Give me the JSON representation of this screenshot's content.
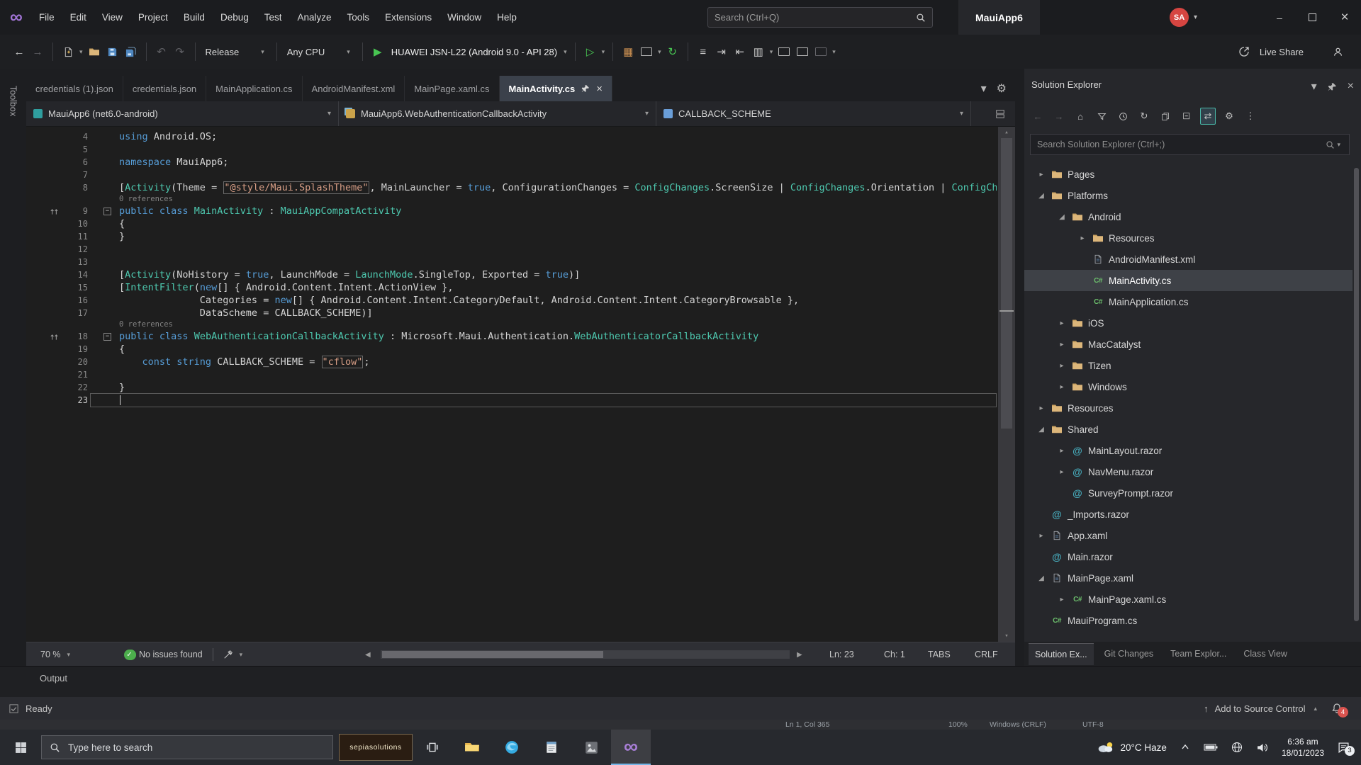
{
  "colors": {
    "keyword_blue": "#569cd6",
    "type_teal": "#4ec9b0",
    "string_orange": "#d69d85",
    "folder_yellow": "#dcb67a",
    "run_green": "#48c552",
    "badge_red": "#d9534f",
    "selection_gray": "#3e4147"
  },
  "glyphs": {
    "caret_down": "▾",
    "caret_up": "▴",
    "close": "×",
    "minimize": "–",
    "back": "←",
    "forward": "→",
    "undo": "↶",
    "redo": "↷",
    "play": "▶",
    "play_outline": "▷",
    "home": "⌂",
    "refresh": "↻",
    "swap": "⇄",
    "gear": "⚙",
    "more": "⋮",
    "check": "✓",
    "up_arrow": "↑",
    "collapsed": "▸",
    "expanded": "◢",
    "infinity": "∞",
    "lines": "≡",
    "indent": "⇥",
    "outdent": "⇤",
    "grid": "▦",
    "grid2": "▥",
    "share": "↗",
    "minus": "−",
    "left": "◀",
    "right": "▶",
    "ellipsis": "…"
  },
  "title_bar": {
    "menus": [
      "File",
      "Edit",
      "View",
      "Project",
      "Build",
      "Debug",
      "Test",
      "Analyze",
      "Tools",
      "Extensions",
      "Window",
      "Help"
    ],
    "search_placeholder": "Search (Ctrl+Q)",
    "window_title": "MauiApp6",
    "avatar": "SA"
  },
  "toolbar": {
    "config": "Release",
    "platform": "Any CPU",
    "run_target": "HUAWEI JSN-L22 (Android 9.0 - API 28)",
    "live_share": "Live Share"
  },
  "tabs": [
    {
      "label": "credentials (1).json",
      "active": false
    },
    {
      "label": "credentials.json",
      "active": false
    },
    {
      "label": "MainApplication.cs",
      "active": false
    },
    {
      "label": "AndroidManifest.xml",
      "active": false
    },
    {
      "label": "MainPage.xaml.cs",
      "active": false
    },
    {
      "label": "MainActivity.cs",
      "active": true
    }
  ],
  "breadcrumbs": [
    "MauiApp6 (net6.0-android)",
    "MauiApp6.WebAuthenticationCallbackActivity",
    "CALLBACK_SCHEME"
  ],
  "editor": {
    "zoom": "70 %",
    "issues": "No issues found",
    "line_status": "Ln: 23",
    "col_status": "Ch: 1",
    "tabs_status": "TABS",
    "eol_status": "CRLF",
    "lines": [
      {
        "n": 4,
        "t": [
          [
            "kw",
            "using"
          ],
          [
            "pl",
            " Android.OS;"
          ]
        ]
      },
      {
        "n": 5,
        "t": []
      },
      {
        "n": 6,
        "t": [
          [
            "kw",
            "namespace"
          ],
          [
            "pl",
            " MauiApp6;"
          ]
        ]
      },
      {
        "n": 7,
        "t": []
      },
      {
        "n": 8,
        "t": [
          [
            "pl",
            "["
          ],
          [
            "ty",
            "Activity"
          ],
          [
            "pl",
            "(Theme = "
          ],
          [
            "sb",
            "\"@style/Maui.SplashTheme\""
          ],
          [
            "pl",
            ", MainLauncher = "
          ],
          [
            "kw",
            "true"
          ],
          [
            "pl",
            ", ConfigurationChanges = "
          ],
          [
            "ty",
            "ConfigChanges"
          ],
          [
            "pl",
            ".ScreenSize | "
          ],
          [
            "ty",
            "ConfigChanges"
          ],
          [
            "pl",
            ".Orientation | "
          ],
          [
            "ty",
            "ConfigChar"
          ]
        ]
      },
      {
        "cl": "0 references"
      },
      {
        "n": 9,
        "fold": true,
        "glyph": true,
        "t": [
          [
            "kw",
            "public"
          ],
          [
            "pl",
            " "
          ],
          [
            "kw",
            "class"
          ],
          [
            "pl",
            " "
          ],
          [
            "ty",
            "MainActivity"
          ],
          [
            "pl",
            " : "
          ],
          [
            "ty",
            "MauiAppCompatActivity"
          ]
        ]
      },
      {
        "n": 10,
        "t": [
          [
            "pl",
            "{"
          ]
        ]
      },
      {
        "n": 11,
        "t": [
          [
            "pl",
            "}"
          ]
        ]
      },
      {
        "n": 12,
        "t": []
      },
      {
        "n": 13,
        "t": []
      },
      {
        "n": 14,
        "t": [
          [
            "pl",
            "["
          ],
          [
            "ty",
            "Activity"
          ],
          [
            "pl",
            "(NoHistory = "
          ],
          [
            "kw",
            "true"
          ],
          [
            "pl",
            ", LaunchMode = "
          ],
          [
            "ty",
            "LaunchMode"
          ],
          [
            "pl",
            ".SingleTop, Exported = "
          ],
          [
            "kw",
            "true"
          ],
          [
            "pl",
            ")]"
          ]
        ]
      },
      {
        "n": 15,
        "t": [
          [
            "pl",
            "["
          ],
          [
            "ty",
            "IntentFilter"
          ],
          [
            "pl",
            "("
          ],
          [
            "kw",
            "new"
          ],
          [
            "pl",
            "[] { Android.Content.Intent.ActionView },"
          ]
        ]
      },
      {
        "n": 16,
        "t": [
          [
            "pl",
            "              Categories = "
          ],
          [
            "kw",
            "new"
          ],
          [
            "pl",
            "[] { Android.Content.Intent.CategoryDefault, Android.Content.Intent.CategoryBrowsable },"
          ]
        ]
      },
      {
        "n": 17,
        "t": [
          [
            "pl",
            "              DataScheme = CALLBACK_SCHEME)]"
          ]
        ]
      },
      {
        "cl": "0 references"
      },
      {
        "n": 18,
        "fold": true,
        "glyph": true,
        "t": [
          [
            "kw",
            "public"
          ],
          [
            "pl",
            " "
          ],
          [
            "kw",
            "class"
          ],
          [
            "pl",
            " "
          ],
          [
            "ty",
            "WebAuthenticationCallbackActivity"
          ],
          [
            "pl",
            " : Microsoft.Maui.Authentication."
          ],
          [
            "ty",
            "WebAuthenticatorCallbackActivity"
          ]
        ]
      },
      {
        "n": 19,
        "t": [
          [
            "pl",
            "{"
          ]
        ]
      },
      {
        "n": 20,
        "t": [
          [
            "pl",
            "    "
          ],
          [
            "kw",
            "const"
          ],
          [
            "pl",
            " "
          ],
          [
            "kw",
            "string"
          ],
          [
            "pl",
            " CALLBACK_SCHEME = "
          ],
          [
            "sb",
            "\"cflow\""
          ],
          [
            "pl",
            ";"
          ]
        ]
      },
      {
        "n": 21,
        "t": []
      },
      {
        "n": 22,
        "t": [
          [
            "pl",
            "}"
          ]
        ]
      },
      {
        "n": 23,
        "cur": true,
        "t": []
      }
    ]
  },
  "solution_explorer": {
    "title": "Solution Explorer",
    "search_placeholder": "Search Solution Explorer (Ctrl+;)",
    "items": [
      {
        "label": "Pages",
        "level": 0,
        "icon": "folder",
        "state": "collapsed"
      },
      {
        "label": "Platforms",
        "level": 0,
        "icon": "folder",
        "state": "expanded"
      },
      {
        "label": "Android",
        "level": 1,
        "icon": "folder",
        "state": "expanded"
      },
      {
        "label": "Resources",
        "level": 2,
        "icon": "folder",
        "state": "collapsed"
      },
      {
        "label": "AndroidManifest.xml",
        "level": 2,
        "icon": "xml",
        "state": "none"
      },
      {
        "label": "MainActivity.cs",
        "level": 2,
        "icon": "cs",
        "state": "none",
        "selected": true
      },
      {
        "label": "MainApplication.cs",
        "level": 2,
        "icon": "cs",
        "state": "none"
      },
      {
        "label": "iOS",
        "level": 1,
        "icon": "folder",
        "state": "collapsed"
      },
      {
        "label": "MacCatalyst",
        "level": 1,
        "icon": "folder",
        "state": "collapsed"
      },
      {
        "label": "Tizen",
        "level": 1,
        "icon": "folder",
        "state": "collapsed"
      },
      {
        "label": "Windows",
        "level": 1,
        "icon": "folder",
        "state": "collapsed"
      },
      {
        "label": "Resources",
        "level": 0,
        "icon": "folder",
        "state": "collapsed"
      },
      {
        "label": "Shared",
        "level": 0,
        "icon": "folder",
        "state": "expanded"
      },
      {
        "label": "MainLayout.razor",
        "level": 1,
        "icon": "razor",
        "state": "collapsed"
      },
      {
        "label": "NavMenu.razor",
        "level": 1,
        "icon": "razor",
        "state": "collapsed"
      },
      {
        "label": "SurveyPrompt.razor",
        "level": 1,
        "icon": "razor",
        "state": "none"
      },
      {
        "label": "_Imports.razor",
        "level": 0,
        "icon": "razor",
        "state": "none"
      },
      {
        "label": "App.xaml",
        "level": 0,
        "icon": "xaml",
        "state": "collapsed"
      },
      {
        "label": "Main.razor",
        "level": 0,
        "icon": "razor",
        "state": "none"
      },
      {
        "label": "MainPage.xaml",
        "level": 0,
        "icon": "xaml",
        "state": "expanded"
      },
      {
        "label": "MainPage.xaml.cs",
        "level": 1,
        "icon": "cs",
        "state": "collapsed"
      },
      {
        "label": "MauiProgram.cs",
        "level": 0,
        "icon": "cs",
        "state": "none"
      }
    ],
    "bottom_tabs": [
      {
        "label": "Solution Ex...",
        "active": true
      },
      {
        "label": "Git Changes",
        "active": false
      },
      {
        "label": "Team Explor...",
        "active": false
      },
      {
        "label": "Class View",
        "active": false
      }
    ]
  },
  "panels": {
    "output": "Output",
    "toolbox": "Toolbox"
  },
  "status_bar": {
    "ready": "Ready",
    "add_to_source": "Add to Source Control",
    "notifications": "4"
  },
  "background_window": {
    "items": [
      "Ln 1, Col 365",
      "100%",
      "Windows (CRLF)",
      "UTF-8"
    ]
  },
  "taskbar": {
    "search_placeholder": "Type here to search",
    "pinned_logo": "sepiasolutions",
    "weather": "20°C Haze",
    "time": "6:36 am",
    "date": "18/01/2023",
    "notification_count": "3"
  }
}
